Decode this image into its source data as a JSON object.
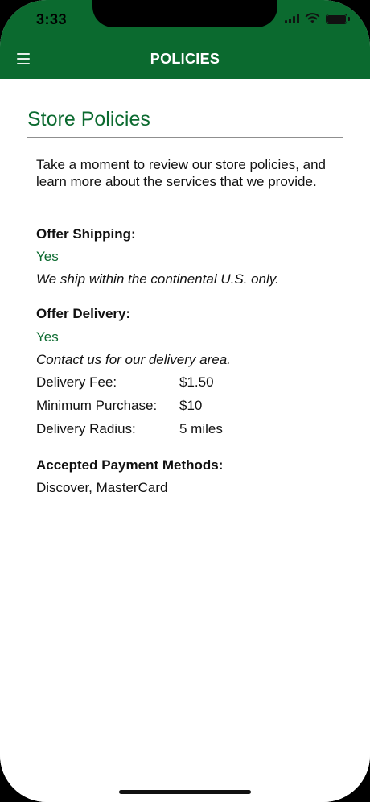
{
  "status_bar": {
    "time": "3:33"
  },
  "header": {
    "title": "POLICIES"
  },
  "page": {
    "title": "Store Policies",
    "intro": "Take a moment to review our store policies, and learn more about the services that we provide."
  },
  "shipping": {
    "heading": "Offer Shipping:",
    "value": "Yes",
    "note": "We ship within the continental U.S. only."
  },
  "delivery": {
    "heading": "Offer Delivery:",
    "value": "Yes",
    "note": "Contact us for our delivery area.",
    "details": [
      {
        "label": "Delivery Fee:",
        "value": "$1.50"
      },
      {
        "label": "Minimum Purchase:",
        "value": "$10"
      },
      {
        "label": "Delivery Radius:",
        "value": "5 miles"
      }
    ]
  },
  "payment": {
    "heading": "Accepted Payment Methods:",
    "value": "Discover, MasterCard"
  },
  "icons": {
    "menu": "menu-icon",
    "signal": "signal-icon",
    "wifi": "wifi-icon",
    "battery": "battery-icon"
  },
  "colors": {
    "brand_green": "#0b6a2f",
    "text": "#111111",
    "divider": "#8f8f8f"
  }
}
